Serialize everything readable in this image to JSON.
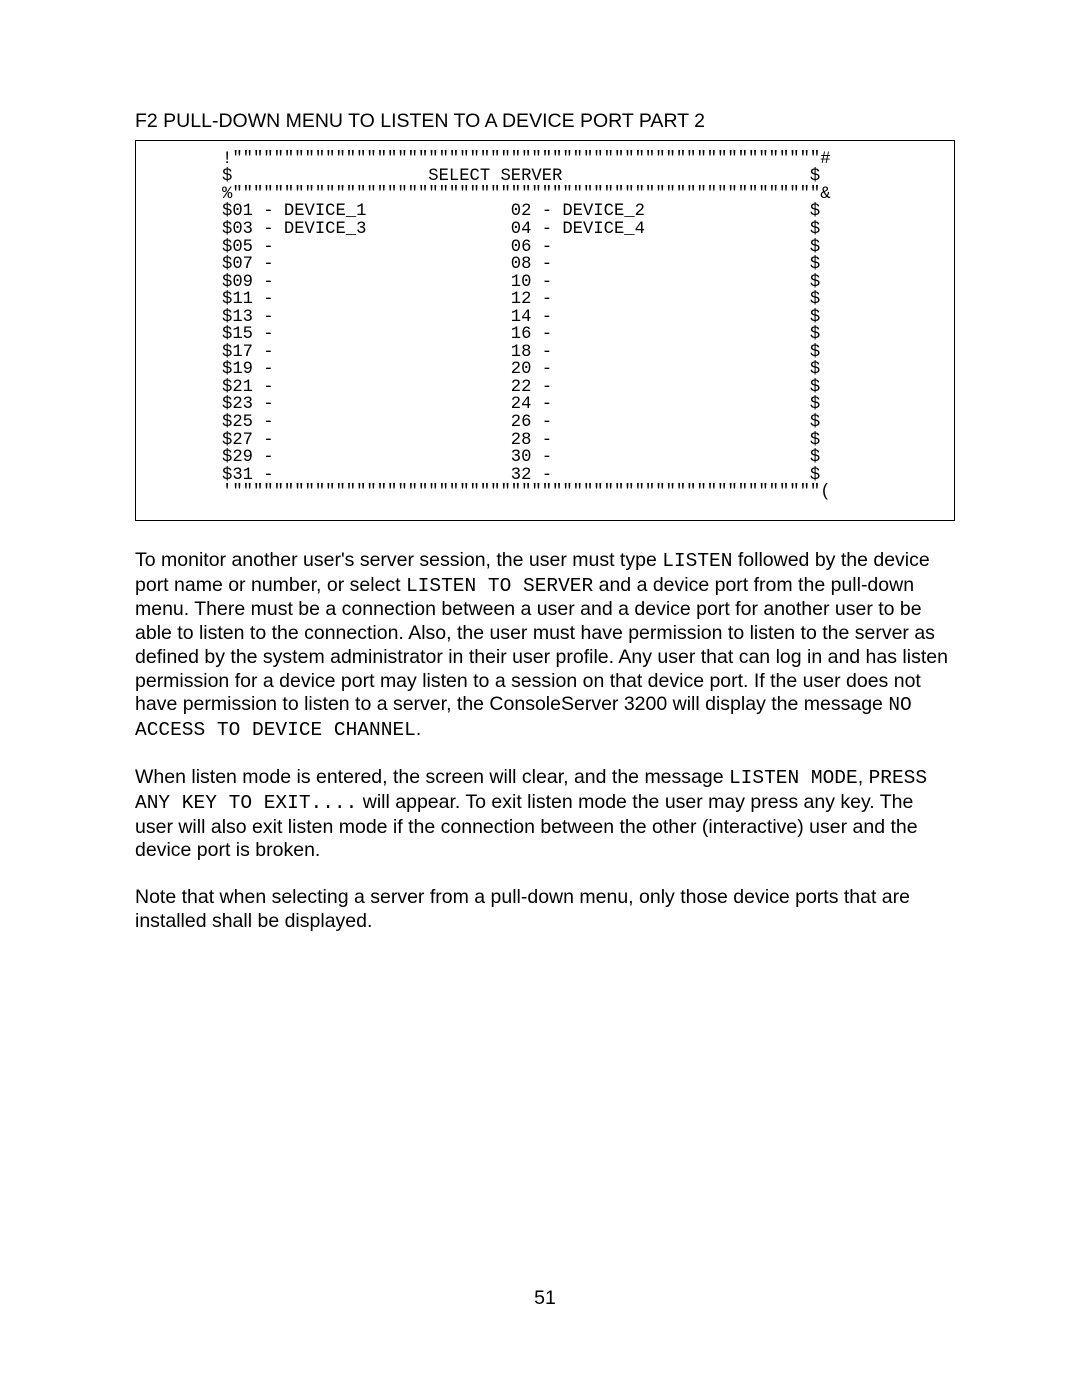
{
  "section_title": "F2 PULL-DOWN MENU TO LISTEN TO A DEVICE PORT PART 2",
  "terminal": "!\"\"\"\"\"\"\"\"\"\"\"\"\"\"\"\"\"\"\"\"\"\"\"\"\"\"\"\"\"\"\"\"\"\"\"\"\"\"\"\"\"\"\"\"\"\"\"\"\"\"\"\"\"\"\"\"\"#\n$                   SELECT SERVER                        $\n%\"\"\"\"\"\"\"\"\"\"\"\"\"\"\"\"\"\"\"\"\"\"\"\"\"\"\"\"\"\"\"\"\"\"\"\"\"\"\"\"\"\"\"\"\"\"\"\"\"\"\"\"\"\"\"\"\"&\n$01 - DEVICE_1              02 - DEVICE_2                $\n$03 - DEVICE_3              04 - DEVICE_4                $\n$05 -                       06 -                         $\n$07 -                       08 -                         $\n$09 -                       10 -                         $\n$11 -                       12 -                         $\n$13 -                       14 -                         $\n$15 -                       16 -                         $\n$17 -                       18 -                         $\n$19 -                       20 -                         $\n$21 -                       22 -                         $\n$23 -                       24 -                         $\n$25 -                       26 -                         $\n$27 -                       28 -                         $\n$29 -                       30 -                         $\n$31 -                       32 -                         $\n'\"\"\"\"\"\"\"\"\"\"\"\"\"\"\"\"\"\"\"\"\"\"\"\"\"\"\"\"\"\"\"\"\"\"\"\"\"\"\"\"\"\"\"\"\"\"\"\"\"\"\"\"\"\"\"\"\"(",
  "p1a": "To monitor another user's server session, the user must type ",
  "m1": "LISTEN",
  "p1b": " followed by the device port name or number, or select ",
  "m2": "LISTEN TO SERVER",
  "p1c": " and a device port from the pull-down menu.  There must be a connection between a user and a device port for another user to be able to listen to the connection.  Also, the user must have permission to listen to the server as defined by the system administrator in their user profile.  Any user that can log in and has listen permission for a device port may listen to a session on that device port.  If the user does not have permission to listen to a server, the ConsoleServer 3200 will display the message ",
  "m3": "NO ACCESS TO DEVICE CHANNEL",
  "p1d": ".",
  "p2a": "When listen mode is entered, the screen will clear, and the message ",
  "m4": "LISTEN MODE",
  "p2b": ", ",
  "m5": "PRESS ANY KEY TO EXIT....",
  "p2c": " will appear.  To exit listen mode the user may press any key.  The user will also exit listen mode if the connection between the other (interactive) user and the device port is broken.",
  "p3": "Note that when selecting a server from a pull-down menu, only those device ports that are installed shall be displayed.",
  "page_number": "51"
}
